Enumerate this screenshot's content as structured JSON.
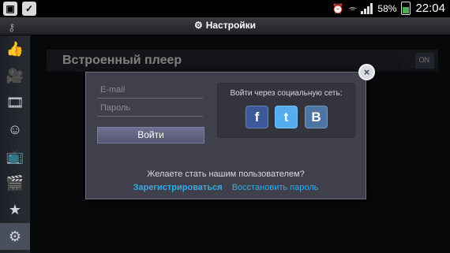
{
  "status_bar": {
    "battery": "58%",
    "time": "22:04"
  },
  "header": {
    "title": "Настройки"
  },
  "settings": {
    "player_label": "Встроенный плеер",
    "toggle_label": "ON",
    "toggle_on": true
  },
  "sidebar": {
    "items": [
      {
        "icon": "thumbs-up-icon"
      },
      {
        "icon": "video-camera-icon"
      },
      {
        "icon": "film-strip-icon"
      },
      {
        "icon": "face-icon"
      },
      {
        "icon": "tv-icon"
      },
      {
        "icon": "clapperboard-icon"
      },
      {
        "icon": "star-icon"
      },
      {
        "icon": "gear-icon"
      }
    ]
  },
  "login_dialog": {
    "email_placeholder": "E-mail",
    "password_placeholder": "Пароль",
    "login_button": "Войти",
    "social_title": "Войти через социальную сеть:",
    "social_buttons": [
      {
        "letter": "f",
        "color": "#3b5998"
      },
      {
        "letter": "t",
        "color": "#55acee"
      },
      {
        "letter": "B",
        "color": "#4c75a3"
      }
    ],
    "question": "Желаете стать нашим пользователем?",
    "register_link": "Зарегистрироваться",
    "recover_link": "Восстановить пароль",
    "close_glyph": "×"
  },
  "colors": {
    "accent_link": "#38a9e0",
    "dialog_bg": "#3f404b"
  }
}
